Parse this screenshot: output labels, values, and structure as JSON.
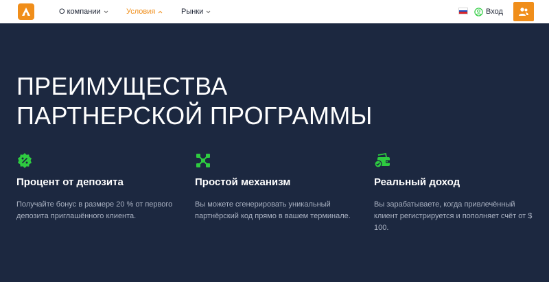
{
  "header": {
    "nav": [
      {
        "label": "О компании",
        "active": false
      },
      {
        "label": "Условия",
        "active": true
      },
      {
        "label": "Рынки",
        "active": false
      }
    ],
    "login_label": "Вход",
    "language_flag": "ru-flag-icon",
    "user_button_icon": "users-icon"
  },
  "hero": {
    "title_line1": "ПРЕИМУЩЕСТВА",
    "title_line2": "ПАРТНЕРСКОЙ ПРОГРАММЫ"
  },
  "features": [
    {
      "icon": "percent-badge-icon",
      "title": "Процент от депозита",
      "text": "Получайте бонус в размере 20 % от первого депозита приглашённого клиента."
    },
    {
      "icon": "network-nodes-icon",
      "title": "Простой механизм",
      "text": "Вы можете сгенерировать уникальный партнёрский код прямо в вашем терминале."
    },
    {
      "icon": "wallet-check-icon",
      "title": "Реальный доход",
      "text": "Вы зарабатываете, когда привлечённый клиент регистрируется и пополняет счёт от $ 100."
    }
  ],
  "colors": {
    "accent": "#f08e1a",
    "background": "#1c2840",
    "icon_green": "#2ecc40",
    "muted_text": "#aab2c2"
  }
}
